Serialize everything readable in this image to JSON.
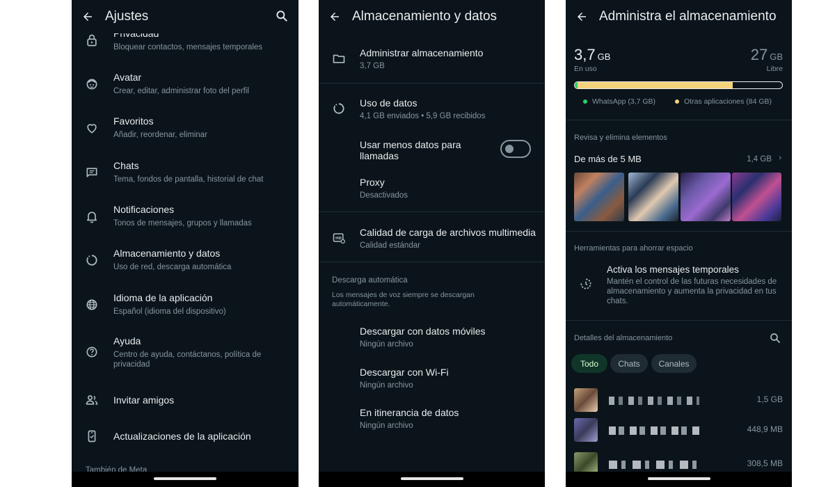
{
  "screen1": {
    "title": "Ajustes",
    "items": [
      {
        "label": "Privacidad",
        "desc": "Bloquear contactos, mensajes temporales",
        "icon": "lock-icon"
      },
      {
        "label": "Avatar",
        "desc": "Crear, editar, administrar foto del perfil",
        "icon": "avatar-icon"
      },
      {
        "label": "Favoritos",
        "desc": "Añadir, reordenar, eliminar",
        "icon": "heart-icon"
      },
      {
        "label": "Chats",
        "desc": "Tema, fondos de pantalla, historial de chat",
        "icon": "chat-icon"
      },
      {
        "label": "Notificaciones",
        "desc": "Tonos de mensajes, grupos y llamadas",
        "icon": "bell-icon"
      },
      {
        "label": "Almacenamiento y datos",
        "desc": "Uso de red, descarga automática",
        "icon": "data-circle-icon"
      },
      {
        "label": "Idioma de la aplicación",
        "desc": "Español (idioma del dispositivo)",
        "icon": "globe-icon"
      },
      {
        "label": "Ayuda",
        "desc": "Centro de ayuda, contáctanos, política de privacidad",
        "icon": "help-icon"
      },
      {
        "label": "Invitar amigos",
        "desc": "",
        "icon": "people-icon"
      },
      {
        "label": "Actualizaciones de la aplicación",
        "desc": "",
        "icon": "phone-update-icon"
      }
    ],
    "section_meta": "También de Meta"
  },
  "screen2": {
    "title": "Almacenamiento y datos",
    "manage": {
      "label": "Administrar almacenamiento",
      "desc": "3,7 GB"
    },
    "usage": {
      "label": "Uso de datos",
      "desc": "4,1 GB enviados • 5,9 GB recibidos"
    },
    "less_data": {
      "label": "Usar menos datos para llamadas",
      "enabled": false
    },
    "proxy": {
      "label": "Proxy",
      "desc": "Desactivados"
    },
    "quality": {
      "label": "Calidad de carga de archivos multimedia",
      "desc": "Calidad estándar"
    },
    "auto_download": {
      "header": "Descarga automática",
      "note": "Los mensajes de voz siempre se descargan automáticamente.",
      "items": [
        {
          "label": "Descargar con datos móviles",
          "desc": "Ningún archivo"
        },
        {
          "label": "Descargar con Wi-Fi",
          "desc": "Ningún archivo"
        },
        {
          "label": "En itinerancia de datos",
          "desc": "Ningún archivo"
        }
      ]
    }
  },
  "screen3": {
    "title": "Administra el almacenamiento",
    "used_value": "3,7",
    "used_unit": "GB",
    "used_label": "En uso",
    "free_value": "27",
    "free_unit": "GB",
    "free_label": "Libre",
    "bar": {
      "whatsapp_fraction": 0.012,
      "other_fraction": 0.75
    },
    "legend_whatsapp": "WhatsApp (3,7 GB)",
    "legend_other": "Otras aplicaciones (84 GB)",
    "colors": {
      "whatsapp": "#25d366",
      "other": "#f4d27b",
      "accent_chip": "#103629"
    },
    "review_header": "Revisa y elimina elementos",
    "larger_label": "De más de 5 MB",
    "larger_size": "1,4 GB",
    "tools_header": "Herramientas para ahorrar espacio",
    "temp_title": "Activa los mensajes temporales",
    "temp_desc": "Mantén el control de las futuras necesidades de almacenamiento y aumenta la privacidad en tus chats.",
    "details_header": "Detalles del almacenamiento",
    "chips": [
      "Todo",
      "Chats",
      "Canales"
    ],
    "chats": [
      {
        "size": "1,5 GB"
      },
      {
        "size": "448,9 MB"
      },
      {
        "size": "308,5 MB"
      }
    ]
  }
}
